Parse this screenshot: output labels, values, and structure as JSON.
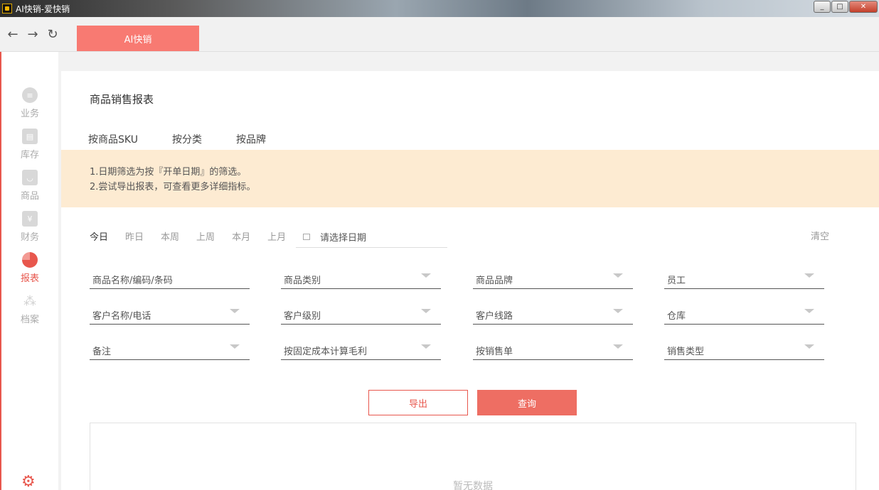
{
  "window": {
    "title": "AI快销-爱快销",
    "min_icon": "minimize-icon",
    "max_icon": "maximize-icon",
    "close_icon": "close-icon"
  },
  "browser": {
    "back_icon": "arrow-left-icon",
    "forward_icon": "arrow-right-icon",
    "refresh_icon": "refresh-icon",
    "tab_label": "AI快销",
    "accent": "#f87a72"
  },
  "sidebar": {
    "items": [
      {
        "label": "业务",
        "icon": "list-icon"
      },
      {
        "label": "库存",
        "icon": "box-icon"
      },
      {
        "label": "商品",
        "icon": "bag-icon"
      },
      {
        "label": "财务",
        "icon": "yen-icon"
      },
      {
        "label": "报表",
        "icon": "pie-chart-icon",
        "active": true
      },
      {
        "label": "档案",
        "icon": "people-icon"
      }
    ],
    "settings_icon": "gear-icon",
    "accent": "#e8574d"
  },
  "page": {
    "title": "商品销售报表",
    "tabs": [
      "按商品SKU",
      "按分类",
      "按品牌"
    ],
    "notice": [
      "1.日期筛选为按『开单日期』的筛选。",
      "2.尝试导出报表，可查看更多详细指标。"
    ],
    "date_shortcuts": [
      "今日",
      "昨日",
      "本周",
      "上周",
      "本月",
      "上月"
    ],
    "date_placeholder": "请选择日期",
    "clear_label": "清空",
    "filters": [
      "商品名称/编码/条码",
      "商品类别",
      "商品品牌",
      "员工",
      "客户名称/电话",
      "客户级别",
      "客户线路",
      "仓库",
      "备注",
      "按固定成本计算毛利",
      "按销售单",
      "销售类型"
    ],
    "export_label": "导出",
    "query_label": "查询",
    "empty_text": "暂无数据"
  }
}
